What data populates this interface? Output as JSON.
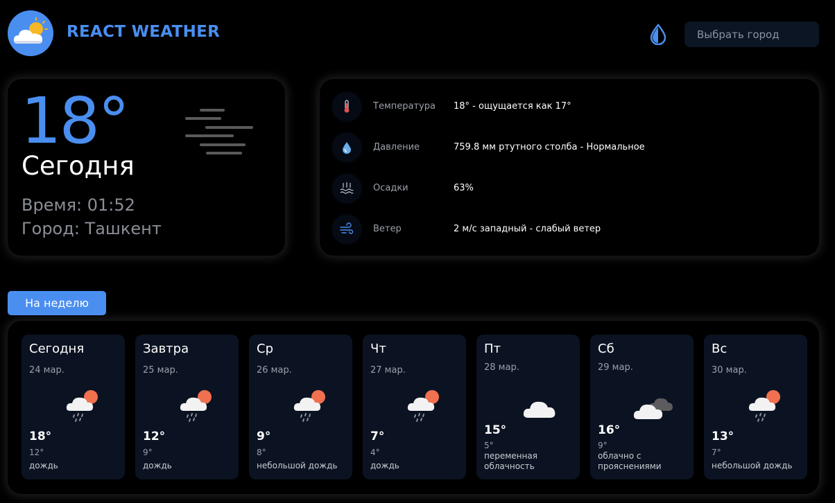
{
  "header": {
    "title": "REACT WEATHER",
    "logo_icon": "cloud-sun-icon",
    "theme_icon": "droplet-icon",
    "search_placeholder": "Выбрать город"
  },
  "today": {
    "temperature": "18°",
    "label": "Сегодня",
    "time": "Время: 01:52",
    "city": "Город: Ташкент",
    "icon": "fog-icon"
  },
  "details": [
    {
      "icon": "thermometer-icon",
      "label": "Температура",
      "value": "18° - ощущается как 17°"
    },
    {
      "icon": "pressure-drop-icon",
      "label": "Давление",
      "value": "759.8 мм ртутного столба - Нормальное"
    },
    {
      "icon": "precipitation-icon",
      "label": "Осадки",
      "value": "63%"
    },
    {
      "icon": "wind-icon",
      "label": "Ветер",
      "value": "2 м/с западный - слабый ветер"
    }
  ],
  "week_button_label": "На неделю",
  "days": [
    {
      "name": "Сегодня",
      "date": "24 мар.",
      "temp": "18°",
      "min": "12°",
      "desc": "дождь",
      "icon": "rain-sun-cloud-icon"
    },
    {
      "name": "Завтра",
      "date": "25 мар.",
      "temp": "12°",
      "min": "9°",
      "desc": "дождь",
      "icon": "rain-sun-cloud-icon"
    },
    {
      "name": "Ср",
      "date": "26 мар.",
      "temp": "9°",
      "min": "8°",
      "desc": "небольшой дождь",
      "icon": "rain-sun-cloud-icon"
    },
    {
      "name": "Чт",
      "date": "27 мар.",
      "temp": "7°",
      "min": "4°",
      "desc": "дождь",
      "icon": "rain-sun-cloud-icon"
    },
    {
      "name": "Пт",
      "date": "28 мар.",
      "temp": "15°",
      "min": "5°",
      "desc": "переменная облачность",
      "icon": "cloud-icon"
    },
    {
      "name": "Сб",
      "date": "29 мар.",
      "temp": "16°",
      "min": "9°",
      "desc": "облачно с прояснениями",
      "icon": "two-clouds-icon"
    },
    {
      "name": "Вс",
      "date": "30 мар.",
      "temp": "13°",
      "min": "7°",
      "desc": "небольшой дождь",
      "icon": "rain-sun-cloud-icon"
    }
  ],
  "colors": {
    "accent": "#4a8ef0",
    "background": "#000000",
    "card": "#0b1322",
    "muted_text": "#8a8e96"
  }
}
